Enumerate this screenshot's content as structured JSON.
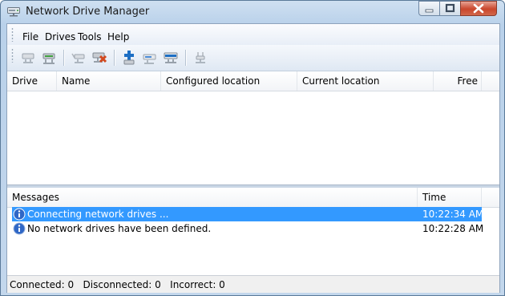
{
  "window": {
    "title": "Network Drive Manager"
  },
  "menu": {
    "file": "File",
    "drives": "Drives",
    "tools": "Tools",
    "help": "Help"
  },
  "toolbar": {
    "icons": [
      "connect-drive-icon",
      "disconnect-drive-icon",
      "connect-all-icon",
      "disconnect-all-icon",
      "add-drive-icon",
      "edit-drive-icon",
      "remove-drive-icon",
      "network-settings-icon"
    ]
  },
  "drives_table": {
    "columns": [
      "Drive",
      "Name",
      "Configured location",
      "Current location",
      "Free"
    ],
    "rows": []
  },
  "messages_table": {
    "columns": [
      "Messages",
      "Time"
    ],
    "rows": [
      {
        "text": "Connecting network drives ...",
        "time": "10:22:34 AM",
        "selected": true
      },
      {
        "text": "No network drives have been defined.",
        "time": "10:22:28 AM",
        "selected": false
      }
    ]
  },
  "status": {
    "text": "Connected: 0   Disconnected: 0   Incorrect: 0"
  },
  "colors": {
    "selection": "#3399ff",
    "title_bar": "#b9d1ea",
    "close_button": "#c9462c"
  }
}
